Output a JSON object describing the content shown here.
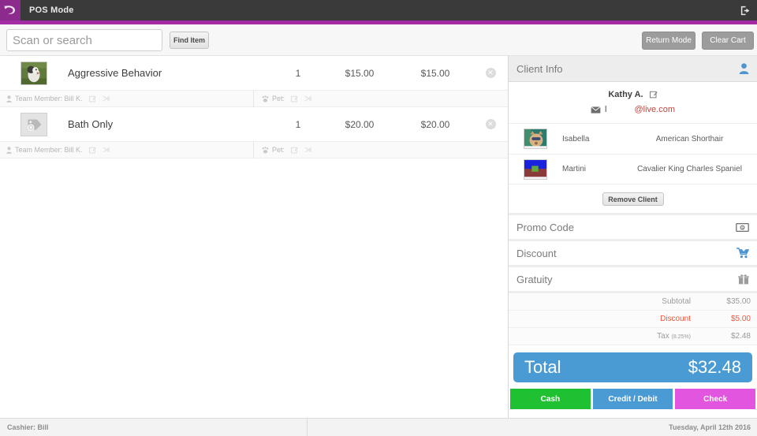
{
  "header": {
    "logo_icon": "swoosh-logo",
    "title": "POS Mode",
    "logout_icon": "logout-icon"
  },
  "search": {
    "placeholder": "Scan or search",
    "value": "",
    "find_item_label": "Find Item",
    "return_mode_label": "Return Mode",
    "clear_cart_label": "Clear Cart"
  },
  "cart": {
    "items": [
      {
        "thumb": "dog-photo",
        "name": "Aggressive Behavior",
        "qty": "1",
        "price": "$15.00",
        "total": "$15.00",
        "remove_icon": "remove-circle-icon",
        "team_member_label": "Team Member: Bill K.",
        "pet_label": "Pet:",
        "edit_icon": "edit-icon",
        "scissors_icon": "scissors-icon",
        "person_icon": "person-icon",
        "paw_icon": "paw-icon"
      },
      {
        "thumb": "tag-placeholder",
        "name": "Bath Only",
        "qty": "1",
        "price": "$20.00",
        "total": "$20.00",
        "remove_icon": "remove-circle-icon",
        "team_member_label": "Team Member: Bill K.",
        "pet_label": "Pet:",
        "edit_icon": "edit-icon",
        "scissors_icon": "scissors-icon",
        "person_icon": "person-icon",
        "paw_icon": "paw-icon"
      }
    ]
  },
  "client": {
    "panel_title": "Client Info",
    "panel_icon": "client-person-icon",
    "name": "Kathy A.",
    "edit_icon": "edit-icon",
    "email_icon": "envelope-icon",
    "email_user": "l",
    "email_domain": "@live.com",
    "pets": [
      {
        "thumb": "cat-photo",
        "name": "Isabella",
        "breed": "American Shorthair"
      },
      {
        "thumb": "dog-photo-2",
        "name": "Martini",
        "breed": "Cavalier King Charles Spaniel"
      }
    ],
    "remove_client_label": "Remove Client"
  },
  "options": [
    {
      "label": "Promo Code",
      "icon": "money-bill-icon"
    },
    {
      "label": "Discount",
      "icon": "shopping-cart-icon"
    },
    {
      "label": "Gratuity",
      "icon": "gift-icon"
    }
  ],
  "totals": {
    "subtotal_label": "Subtotal",
    "subtotal_value": "$35.00",
    "discount_label": "Discount",
    "discount_value": "$5.00",
    "tax_label": "Tax",
    "tax_rate": "(8.25%)",
    "tax_value": "$2.48",
    "total_label": "Total",
    "total_value": "$32.48"
  },
  "payment": {
    "cash_label": "Cash",
    "credit_label": "Credit / Debit",
    "check_label": "Check"
  },
  "footer": {
    "cashier": "Cashier: Bill",
    "date": "Tuesday, April 12th 2016"
  },
  "colors": {
    "accent_purple": "#a32ba3",
    "topbar_dark": "#3a3a3a",
    "blue": "#4a9bd4",
    "green": "#1fc133",
    "magenta": "#e255de",
    "red": "#f4533c"
  }
}
